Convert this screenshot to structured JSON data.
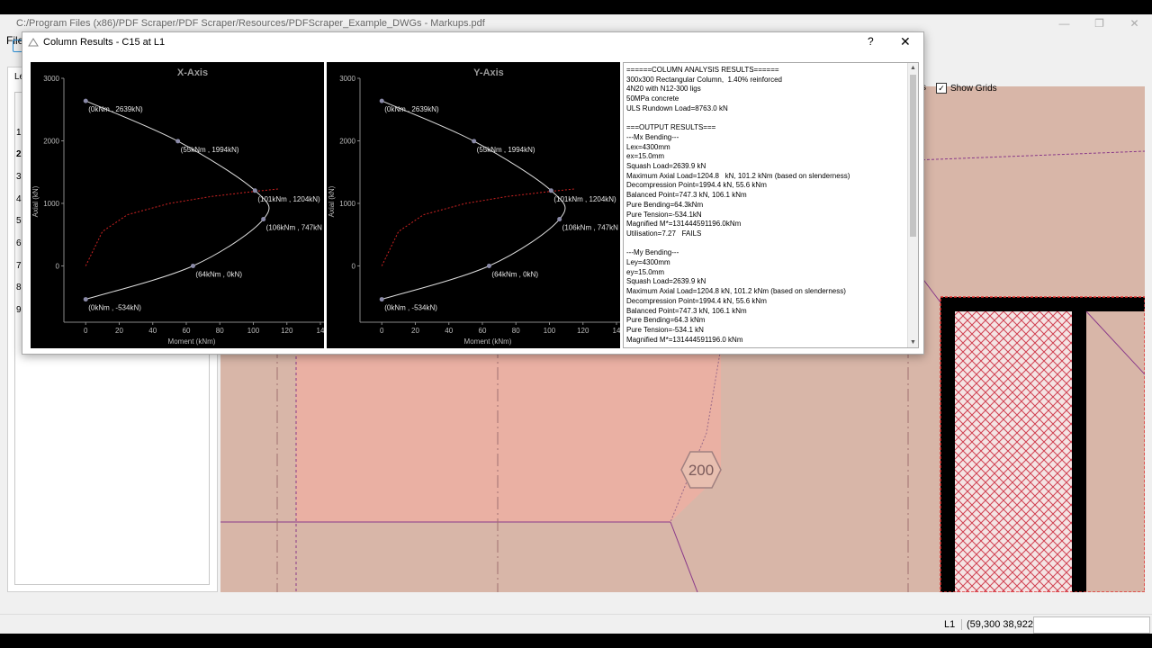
{
  "app": {
    "title": "C:/Program Files (x86)/PDF Scraper/PDF Scraper/Resources/PDFScraper_Example_DWGs - Markups.pdf",
    "menu_file": "File",
    "left_tab_label": "Le",
    "row_numbers": [
      "1",
      "2",
      "3",
      "4",
      "5",
      "6",
      "7",
      "8",
      "9"
    ],
    "show_grids_label": "Show Grids",
    "show_grids_checked": true,
    "partial_label": "s",
    "canvas_tag": "200",
    "level": "L1",
    "coordinates": "(59,300  38,922)"
  },
  "dialog": {
    "title": "Column Results - C15 at L1",
    "help": "?",
    "close": "✕"
  },
  "results_text": "======COLUMN ANALYSIS RESULTS======\n300x300 Rectangular Column,  1.40% reinforced\n4N20 with N12-300 ligs\n50MPa concrete\nULS Rundown Load=8763.0 kN\n\n===OUTPUT RESULTS===\n---Mx Bending---\nLex=4300mm\nex=15.0mm\nSquash Load=2639.9 kN\nMaximum Axial Load=1204.8   kN, 101.2 kNm (based on slenderness)\nDecompression Point=1994.4 kN, 55.6 kNm\nBalanced Point=747.3 kN, 106.1 kNm\nPure Bending=64.3kNm\nPure Tension=-534.1kN\nMagnified M*=131444591196.0kNm\nUtilisation=7.27   FAILS\n\n---My Bending---\nLey=4300mm\ney=15.0mm\nSquash Load=2639.9 kN\nMaximum Axial Load=1204.8 kN, 101.2 kNm (based on slenderness)\nDecompression Point=1994.4 kN, 55.6 kNm\nBalanced Point=747.3 kN, 106.1 kNm\nPure Bending=64.3 kNm\nPure Tension=-534.1 kN\nMagnified M*=131444591196.0 kNm",
  "chart_data": [
    {
      "type": "line",
      "title": "X-Axis",
      "xlabel": "Moment (kNm)",
      "ylabel": "Axial (kN)",
      "xlim": [
        -13,
        140
      ],
      "ylim": [
        -900,
        3000
      ],
      "xticks": [
        "0",
        "20",
        "40",
        "60",
        "80",
        "100",
        "120",
        "14"
      ],
      "yticks": [
        "3000",
        "2000",
        "1000",
        "0"
      ],
      "series": [
        {
          "values": [
            [
              0,
              -534
            ],
            [
              64,
              0
            ],
            [
              106,
              747
            ],
            [
              101,
              1204
            ],
            [
              55,
              1994
            ],
            [
              0,
              2639
            ]
          ]
        },
        {
          "values": [
            [
              0,
              0
            ],
            [
              10,
              550
            ],
            [
              25,
              820
            ],
            [
              50,
              1000
            ],
            [
              75,
              1110
            ],
            [
              100,
              1190
            ],
            [
              115,
              1230
            ]
          ]
        }
      ],
      "labels": [
        "(0kNm , 2639kN)",
        "(55kNm , 1994kN)",
        "(101kNm , 1204kN)",
        "(106kNm , 747kN",
        "(64kNm , 0kN)",
        "(0kNm , -534kN)"
      ],
      "colors": {
        "interaction": "#dddddd",
        "slenderness": "#cc2222",
        "points": "#8a8aa8"
      }
    },
    {
      "type": "line",
      "title": "Y-Axis",
      "xlabel": "Moment (kNm)",
      "ylabel": "Axial (kN)",
      "xlim": [
        -13,
        140
      ],
      "ylim": [
        -900,
        3000
      ],
      "xticks": [
        "0",
        "20",
        "40",
        "60",
        "80",
        "100",
        "120",
        "14"
      ],
      "yticks": [
        "3000",
        "2000",
        "1000",
        "0"
      ],
      "series": [
        {
          "values": [
            [
              0,
              -534
            ],
            [
              64,
              0
            ],
            [
              106,
              747
            ],
            [
              101,
              1204
            ],
            [
              55,
              1994
            ],
            [
              0,
              2639
            ]
          ]
        },
        {
          "values": [
            [
              0,
              0
            ],
            [
              10,
              550
            ],
            [
              25,
              820
            ],
            [
              50,
              1000
            ],
            [
              75,
              1110
            ],
            [
              100,
              1190
            ],
            [
              115,
              1230
            ]
          ]
        }
      ],
      "labels": [
        "(0kNm , 2639kN)",
        "(55kNm , 1994kN)",
        "(101kNm , 1204kN)",
        "(106kNm , 747kN",
        "(64kNm , 0kN)",
        "(0kNm , -534kN)"
      ],
      "colors": {
        "interaction": "#dddddd",
        "slenderness": "#cc2222",
        "points": "#8a8aa8"
      }
    }
  ]
}
